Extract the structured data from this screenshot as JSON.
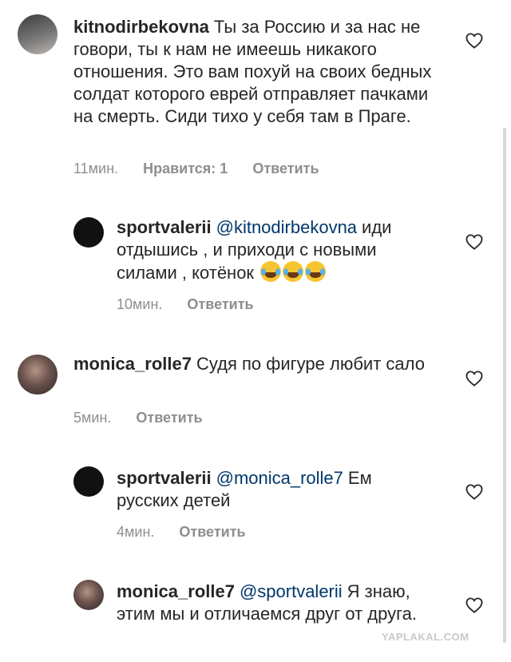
{
  "comments": [
    {
      "username": "kitnodirbekovna",
      "mention": "",
      "text_lines": [
        "Ты за Россию и за нас",
        "не говори, ты к нам не имеешь",
        "никакого отношения. Это вам похуй на",
        "своих бедных солдат которого еврей",
        "отправляет пачками на смерть. Сиди",
        "тихо у себя там в Праге."
      ],
      "time": "11мин.",
      "likes": "Нравится: 1",
      "reply": "Ответить"
    },
    {
      "username": "sportvalerii",
      "mention": "@kitnodirbekovna",
      "text_lines": [
        "иди",
        "отдышись , и приходи с новыми",
        "силами , котёнок"
      ],
      "emoji_count": 3,
      "time": "10мин.",
      "reply": "Ответить"
    },
    {
      "username": "monica_rolle7",
      "mention": "",
      "text_lines": [
        "Судя по фигуре любит",
        "сало"
      ],
      "time": "5мин.",
      "reply": "Ответить"
    },
    {
      "username": "sportvalerii",
      "mention": "@monica_rolle7",
      "text_lines": [
        "Ем",
        "русских детей"
      ],
      "time": "4мин.",
      "reply": "Ответить"
    },
    {
      "username": "monica_rolle7",
      "mention": "@sportvalerii",
      "text_lines": [
        "Я",
        "знаю, этим мы и отличаемся друг",
        "от друга."
      ]
    }
  ],
  "watermark": "YAPLAKAL.COM",
  "colors": {
    "text": "#262626",
    "meta": "#8e8e8e",
    "mention": "#00376b"
  },
  "icons": {
    "like": "heart-outline-icon",
    "emoji": "face-with-tears-of-joy"
  }
}
